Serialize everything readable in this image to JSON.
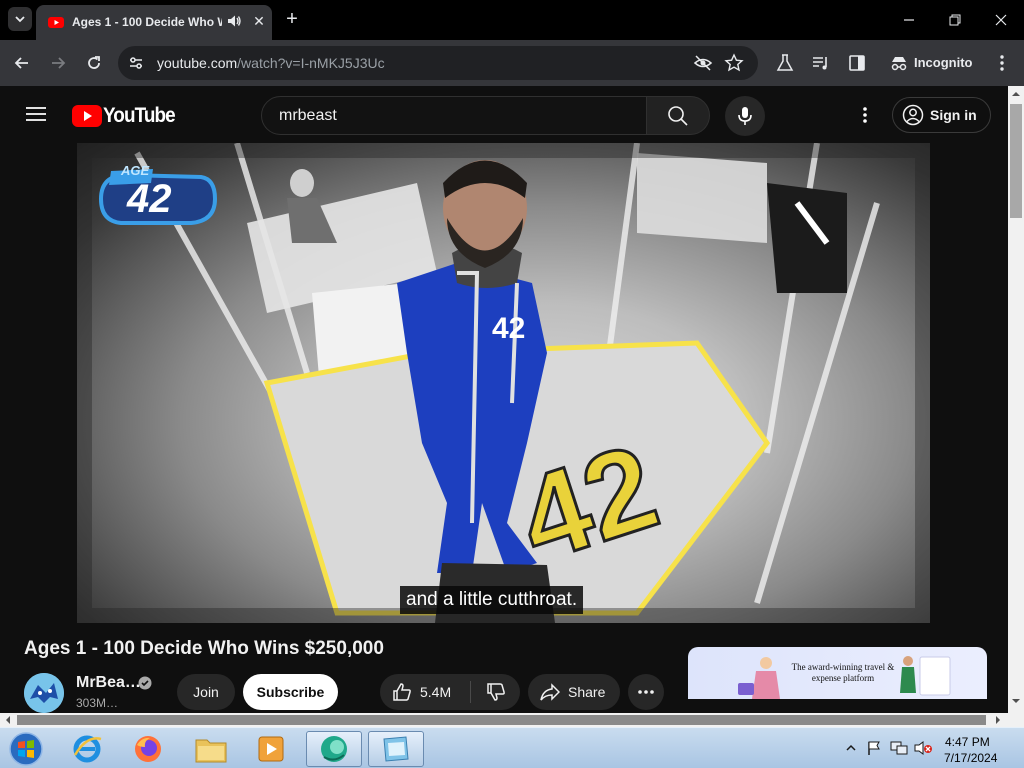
{
  "browser": {
    "tab_title": "Ages 1 - 100 Decide Who Wins $250,000 - YouTube",
    "url_host": "youtube.com",
    "url_path": "/watch?v=I-nMKJ5J3Uc",
    "profile_label": "Incognito"
  },
  "youtube": {
    "wordmark": "YouTube",
    "search_query": "mrbeast",
    "sign_in_label": "Sign in",
    "video": {
      "badge_small": "AGE",
      "badge_number": "42",
      "caption": "and a little cutthroat."
    },
    "title": "Ages 1 - 100 Decide Who Wins $250,000",
    "channel_name": "MrBea…",
    "subscribers": "303M…",
    "join_label": "Join",
    "subscribe_label": "Subscribe",
    "like_count": "5.4M",
    "share_label": "Share",
    "ad_text": "The award-winning travel & expense platform"
  },
  "taskbar": {
    "time": "4:47 PM",
    "date": "7/17/2024"
  },
  "colors": {
    "youtube_red": "#ff0000",
    "page_bg": "#0f0f0f",
    "chrome_toolbar": "#35363a"
  }
}
